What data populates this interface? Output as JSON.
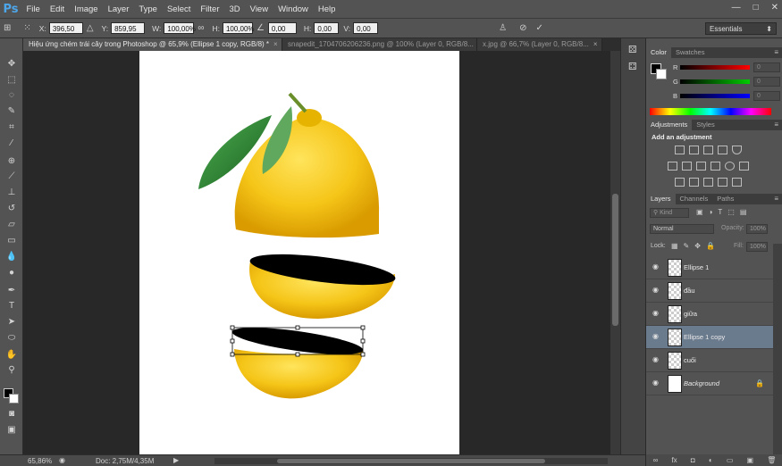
{
  "app": {
    "logo": "Ps",
    "minimize": "—",
    "maximize": "□",
    "close": "✕"
  },
  "menu": [
    "File",
    "Edit",
    "Image",
    "Layer",
    "Type",
    "Select",
    "Filter",
    "3D",
    "View",
    "Window",
    "Help"
  ],
  "options": {
    "x_label": "X:",
    "x_value": "396,50 px",
    "y_label": "Y:",
    "y_value": "859,95 px",
    "w_label": "W:",
    "w_value": "100,00%",
    "h_label": "H:",
    "h_value": "100,00%",
    "angle_value": "0,00",
    "hskew_label": "H:",
    "hskew_value": "0,00",
    "vskew_label": "V:",
    "vskew_value": "0,00",
    "workspace": "Essentials"
  },
  "tabs": [
    {
      "label": "Hiệu ứng chém trái cây trong Photoshop @ 65,9% (Ellipse 1 copy, RGB/8) *",
      "active": true
    },
    {
      "label": "snapedit_1704706206236.png @ 100% (Layer 0, RGB/8...",
      "active": false
    },
    {
      "label": "x.jpg @ 66,7% (Layer 0, RGB/8...",
      "active": false
    }
  ],
  "status": {
    "zoom": "65,86%",
    "doc": "Doc: 2,75M/4,35M"
  },
  "color_panel": {
    "tabs": [
      "Color",
      "Swatches"
    ],
    "r_label": "R",
    "g_label": "G",
    "b_label": "B",
    "r_value": "0",
    "g_value": "0",
    "b_value": "0"
  },
  "adjustments_panel": {
    "tabs": [
      "Adjustments",
      "Styles"
    ],
    "heading": "Add an adjustment"
  },
  "layers_panel": {
    "tabs": [
      "Layers",
      "Channels",
      "Paths"
    ],
    "filter_kind": "Kind",
    "blend_mode": "Normal",
    "opacity_label": "Opacity:",
    "opacity_value": "100%",
    "lock_label": "Lock:",
    "fill_label": "Fill:",
    "fill_value": "100%",
    "layers": [
      {
        "name": "Ellipse 1",
        "type": "shape",
        "selected": false
      },
      {
        "name": "đầu",
        "type": "pixel",
        "selected": false
      },
      {
        "name": "giữa",
        "type": "pixel",
        "selected": false
      },
      {
        "name": "Ellipse 1 copy",
        "type": "shape",
        "selected": true
      },
      {
        "name": "cuối",
        "type": "pixel",
        "selected": false
      },
      {
        "name": "Background",
        "type": "background",
        "selected": false
      }
    ]
  },
  "colors": {
    "accent_blue": "#4ea6ea",
    "lemon": "#f5c518",
    "leaf": "#2e7d32",
    "selection": "#6b7b8e"
  }
}
